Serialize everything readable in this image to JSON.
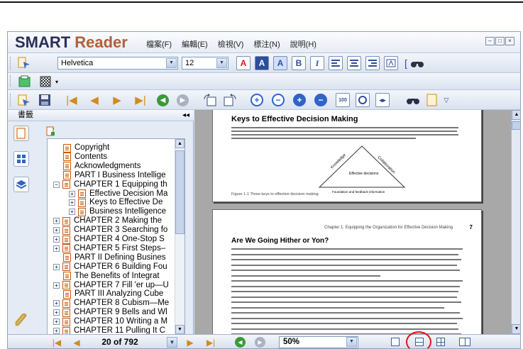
{
  "app": {
    "logo_part1": "SMART",
    "logo_part2": "Reader"
  },
  "menu": [
    "檔案(F)",
    "編輯(E)",
    "檢視(V)",
    "標注(N)",
    "說明(H)"
  ],
  "window_buttons": [
    "–",
    "□",
    "×"
  ],
  "toolbar": {
    "font_name": "Helvetica",
    "font_size": "12",
    "format_buttons": [
      "A",
      "A",
      "A",
      "B",
      "I"
    ],
    "zoom_fit_label": "100"
  },
  "sidebar": {
    "title": "書籤",
    "collapse_glyph": "◂◂",
    "bookmarks": [
      {
        "label": "Copyright",
        "level": 1,
        "expander": ""
      },
      {
        "label": "Contents",
        "level": 1,
        "expander": ""
      },
      {
        "label": "Acknowledgments",
        "level": 1,
        "expander": ""
      },
      {
        "label": "PART I Business Intellige",
        "level": 1,
        "expander": ""
      },
      {
        "label": "CHAPTER 1 Equipping th",
        "level": 1,
        "expander": "−"
      },
      {
        "label": "Effective Decision Ma",
        "level": 2,
        "expander": "+"
      },
      {
        "label": "Keys to Effective De",
        "level": 2,
        "expander": "+"
      },
      {
        "label": "Business Intelligence",
        "level": 2,
        "expander": "+"
      },
      {
        "label": "CHAPTER 2 Making the",
        "level": 1,
        "expander": "+"
      },
      {
        "label": "CHAPTER 3 Searching fo",
        "level": 1,
        "expander": "+"
      },
      {
        "label": "CHAPTER 4 One-Stop S",
        "level": 1,
        "expander": "+"
      },
      {
        "label": "CHAPTER 5 First Steps–",
        "level": 1,
        "expander": "+"
      },
      {
        "label": "PART II Defining Busines",
        "level": 1,
        "expander": ""
      },
      {
        "label": "CHAPTER 6 Building Fou",
        "level": 1,
        "expander": "+"
      },
      {
        "label": "The Benefits of Integrat",
        "level": 1,
        "expander": ""
      },
      {
        "label": "CHAPTER 7 Fill 'er up—U",
        "level": 1,
        "expander": "+"
      },
      {
        "label": "PART III Analyzing Cube",
        "level": 1,
        "expander": ""
      },
      {
        "label": "CHAPTER 8 Cubism—Me",
        "level": 1,
        "expander": "+"
      },
      {
        "label": "CHAPTER 9 Bells and Wl",
        "level": 1,
        "expander": "+"
      },
      {
        "label": "CHAPTER 10 Writing a M",
        "level": 1,
        "expander": "+"
      },
      {
        "label": "CHAPTER 11 Pulling It C",
        "level": 1,
        "expander": "+"
      }
    ]
  },
  "document": {
    "page1": {
      "title": "Keys to Effective Decision Making",
      "diagram_left": "Knowledge",
      "diagram_right": "Collaboration",
      "diagram_center": "Effective decisions",
      "diagram_bottom": "Foundation and feedback information",
      "caption": "Figure 1-1   Three keys to effective decision making"
    },
    "page2": {
      "running_head": "Chapter 1: Equipping the Organization for Effective Decision Making",
      "page_number": "7",
      "title": "Are We Going Hither or Yon?"
    }
  },
  "status": {
    "page_indicator": "20 of 792",
    "zoom": "50%"
  }
}
